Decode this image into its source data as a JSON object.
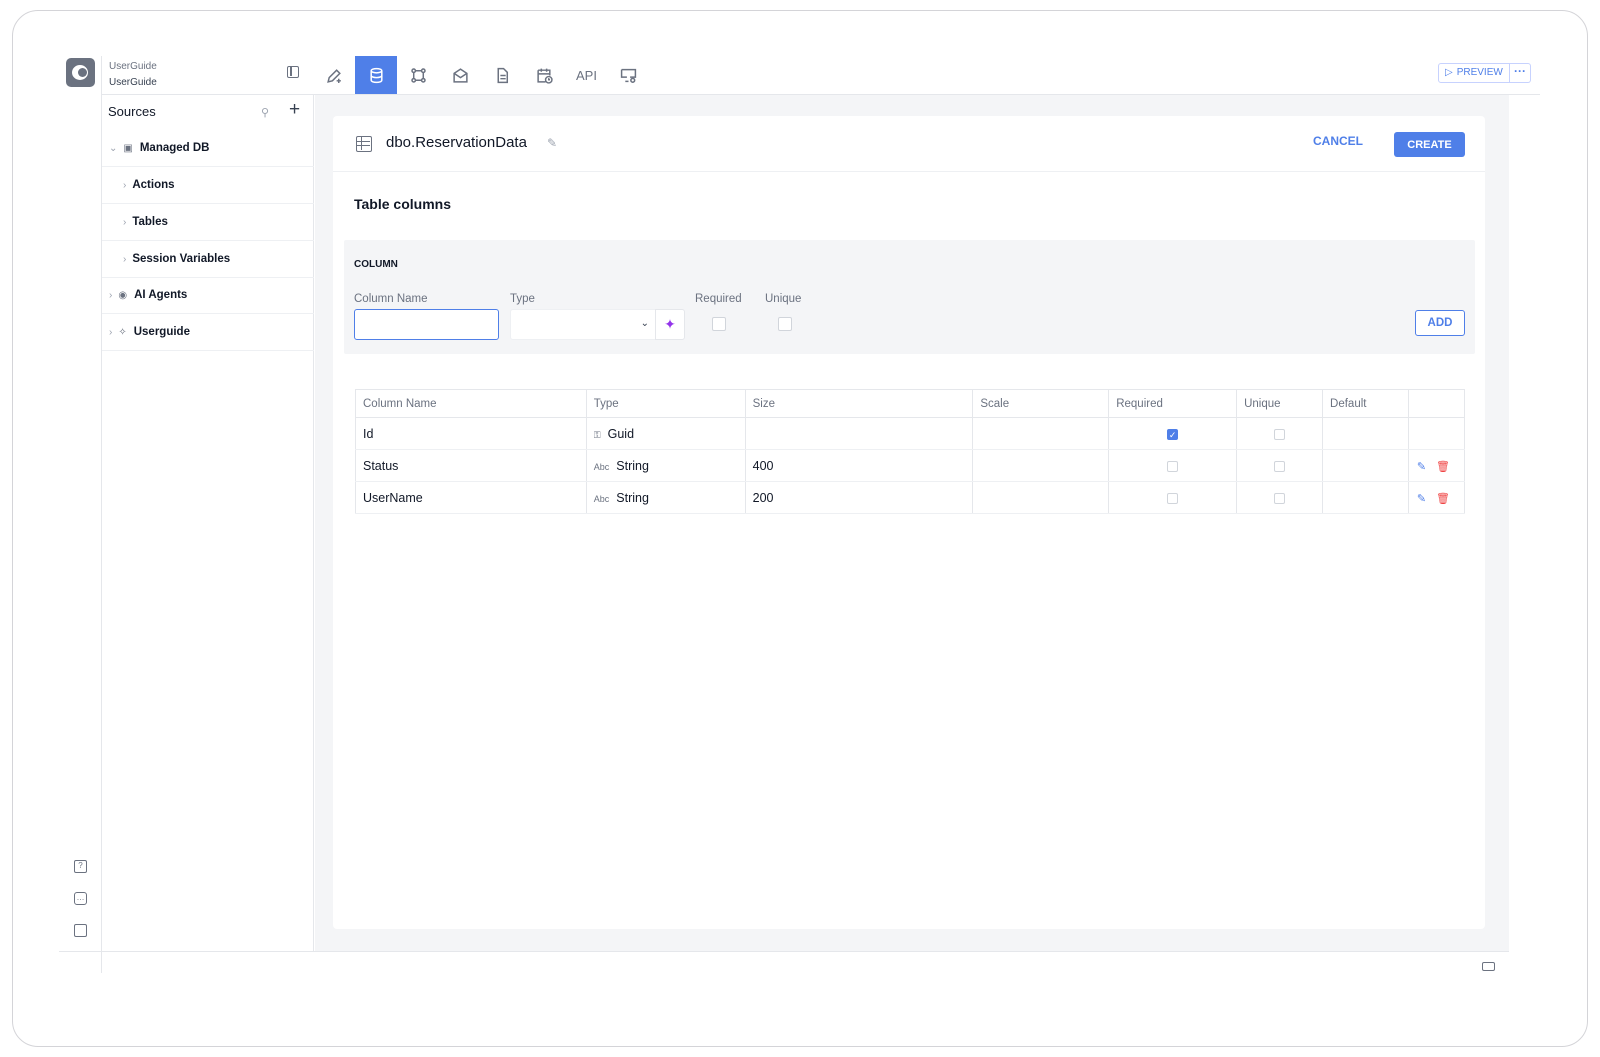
{
  "brand": {
    "workspace": "UserGuide",
    "app": "UserGuide"
  },
  "toolbar": {
    "tabs": [
      {
        "name": "design",
        "icon": "pencil-plus-icon"
      },
      {
        "name": "data",
        "icon": "database-icon",
        "active": true
      },
      {
        "name": "workflows",
        "icon": "workflow-icon"
      },
      {
        "name": "email",
        "icon": "envelope-icon"
      },
      {
        "name": "documents",
        "icon": "document-icon"
      },
      {
        "name": "scheduler",
        "icon": "calendar-clock-icon"
      },
      {
        "name": "api",
        "label": "API"
      },
      {
        "name": "presentation",
        "icon": "monitor-settings-icon"
      }
    ],
    "preview_label": "PREVIEW",
    "more_label": "···"
  },
  "sidebar": {
    "title": "Sources",
    "tree": [
      {
        "label": "Managed DB",
        "expanded": true,
        "icon": "database-icon"
      },
      {
        "label": "Actions",
        "indent": 1
      },
      {
        "label": "Tables",
        "indent": 1
      },
      {
        "label": "Session Variables",
        "indent": 1
      },
      {
        "label": "AI Agents",
        "icon": "eye-icon"
      },
      {
        "label": "Userguide",
        "icon": "sparkle-icon"
      }
    ]
  },
  "editor": {
    "table_name": "dbo.ReservationData",
    "cancel_label": "CANCEL",
    "create_label": "CREATE",
    "section_title": "Table columns",
    "new_column": {
      "header": "COLUMN",
      "name_label": "Column Name",
      "name_value": "",
      "type_label": "Type",
      "type_value": "",
      "required_label": "Required",
      "unique_label": "Unique",
      "add_label": "ADD"
    },
    "columns_table": {
      "headers": [
        "Column Name",
        "Type",
        "Size",
        "Scale",
        "Required",
        "Unique",
        "Default",
        ""
      ],
      "rows": [
        {
          "name": "Id",
          "type": "Guid",
          "type_icon": "key-icon",
          "size": "",
          "scale": "",
          "required": true,
          "unique": false,
          "default": "",
          "editable": false
        },
        {
          "name": "Status",
          "type": "String",
          "type_icon": "Abc",
          "size": "400",
          "scale": "",
          "required": false,
          "unique": false,
          "default": "",
          "editable": true
        },
        {
          "name": "UserName",
          "type": "String",
          "type_icon": "Abc",
          "size": "200",
          "scale": "",
          "required": false,
          "unique": false,
          "default": "",
          "editable": true
        }
      ]
    }
  },
  "colors": {
    "accent": "#4f7fe8",
    "danger": "#ef4444",
    "magic": "#9333ea"
  }
}
